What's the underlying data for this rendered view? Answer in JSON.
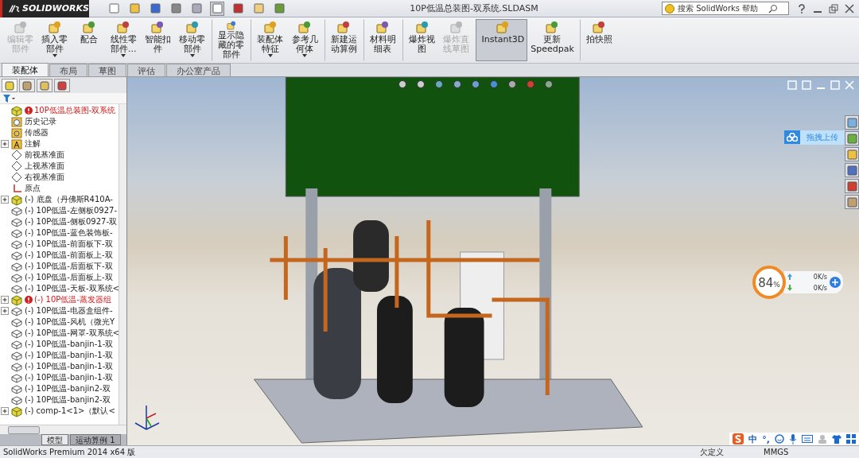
{
  "app": {
    "logo": "SOLIDWORKS",
    "title": "10P低温总装图-双系统.SLDASM"
  },
  "search": {
    "placeholder": "搜索 SolidWorks 帮助"
  },
  "quick_tools": [
    {
      "selected": false
    },
    {
      "selected": false
    },
    {
      "selected": false
    },
    {
      "selected": false
    },
    {
      "selected": false
    },
    {
      "selected": true
    },
    {
      "selected": false
    },
    {
      "selected": false
    },
    {
      "selected": false
    }
  ],
  "ribbon": [
    {
      "label": "编辑零部件",
      "disabled": true,
      "selected": false,
      "dropdown": false,
      "divider_before": false
    },
    {
      "label": "插入零部件",
      "disabled": false,
      "selected": false,
      "dropdown": true,
      "divider_before": false
    },
    {
      "label": "配合",
      "disabled": false,
      "selected": false,
      "dropdown": false,
      "divider_before": false
    },
    {
      "label": "线性零部件...",
      "disabled": false,
      "selected": false,
      "dropdown": true,
      "divider_before": false
    },
    {
      "label": "智能扣件",
      "disabled": false,
      "selected": false,
      "dropdown": false,
      "divider_before": false
    },
    {
      "label": "移动零部件",
      "disabled": false,
      "selected": false,
      "dropdown": true,
      "divider_before": false
    },
    {
      "label": "显示隐藏的零部件",
      "disabled": false,
      "selected": false,
      "dropdown": false,
      "divider_before": true
    },
    {
      "label": "装配体特征",
      "disabled": false,
      "selected": false,
      "dropdown": true,
      "divider_before": true
    },
    {
      "label": "参考几何体",
      "disabled": false,
      "selected": false,
      "dropdown": true,
      "divider_before": false
    },
    {
      "label": "新建运动算例",
      "disabled": false,
      "selected": false,
      "dropdown": false,
      "divider_before": true
    },
    {
      "label": "材料明细表",
      "disabled": false,
      "selected": false,
      "dropdown": false,
      "divider_before": true
    },
    {
      "label": "爆炸视图",
      "disabled": false,
      "selected": false,
      "dropdown": false,
      "divider_before": true
    },
    {
      "label": "爆炸直线草图",
      "disabled": true,
      "selected": false,
      "dropdown": false,
      "divider_before": false
    },
    {
      "label": "Instant3D",
      "disabled": false,
      "selected": true,
      "dropdown": false,
      "divider_before": true
    },
    {
      "label": "更新Speedpak",
      "disabled": false,
      "selected": false,
      "dropdown": false,
      "divider_before": false
    },
    {
      "label": "拍快照",
      "disabled": false,
      "selected": false,
      "dropdown": false,
      "divider_before": true
    }
  ],
  "tabs": [
    {
      "label": "装配体",
      "selected": true
    },
    {
      "label": "布局",
      "selected": false
    },
    {
      "label": "草图",
      "selected": false
    },
    {
      "label": "评估",
      "selected": false
    },
    {
      "label": "办公室产品",
      "selected": false
    }
  ],
  "panel_tabs": [
    {
      "selected": true
    },
    {
      "selected": false
    },
    {
      "selected": false
    },
    {
      "selected": false
    }
  ],
  "tree": [
    {
      "kind": "top",
      "label": "10P低温总装图-双系统",
      "expandable": false,
      "error": true
    },
    {
      "kind": "history",
      "label": "历史记录",
      "expandable": false,
      "error": false
    },
    {
      "kind": "sensor",
      "label": "传感器",
      "expandable": false,
      "error": false
    },
    {
      "kind": "annotation",
      "label": "注解",
      "expandable": true,
      "error": false
    },
    {
      "kind": "plane",
      "label": "前视基准面",
      "expandable": false,
      "error": false
    },
    {
      "kind": "plane",
      "label": "上视基准面",
      "expandable": false,
      "error": false
    },
    {
      "kind": "plane",
      "label": "右视基准面",
      "expandable": false,
      "error": false
    },
    {
      "kind": "origin",
      "label": "原点",
      "expandable": false,
      "error": false
    },
    {
      "kind": "assembly",
      "label": "(-) 底盘（丹佛斯R410A-",
      "expandable": true,
      "error": false
    },
    {
      "kind": "part",
      "label": "(-) 10P低温-左侧板0927-",
      "expandable": false,
      "error": false
    },
    {
      "kind": "part",
      "label": "(-) 10P低温-侧板0927-双",
      "expandable": false,
      "error": false
    },
    {
      "kind": "part",
      "label": "(-) 10P低温-蓝色装饰板-",
      "expandable": false,
      "error": false
    },
    {
      "kind": "part",
      "label": "(-) 10P低温-前面板下-双",
      "expandable": false,
      "error": false
    },
    {
      "kind": "part",
      "label": "(-) 10P低温-前面板上-双",
      "expandable": false,
      "error": false
    },
    {
      "kind": "part",
      "label": "(-) 10P低温-后面板下-双",
      "expandable": false,
      "error": false
    },
    {
      "kind": "part",
      "label": "(-) 10P低温-后面板上-双",
      "expandable": false,
      "error": false
    },
    {
      "kind": "part",
      "label": "(-) 10P低温-天板-双系统<",
      "expandable": false,
      "error": false
    },
    {
      "kind": "assembly",
      "label": "(-) 10P低温-蒸发器组",
      "expandable": true,
      "error": true
    },
    {
      "kind": "part",
      "label": "(-) 10P低温-电器盒组件-",
      "expandable": true,
      "error": false
    },
    {
      "kind": "part",
      "label": "(-) 10P低温-风机（微光Y",
      "expandable": false,
      "error": false
    },
    {
      "kind": "part",
      "label": "(-) 10P低温-网罩-双系统<",
      "expandable": false,
      "error": false
    },
    {
      "kind": "part",
      "label": "(-) 10P低温-banjin-1-双",
      "expandable": false,
      "error": false
    },
    {
      "kind": "part",
      "label": "(-) 10P低温-banjin-1-双",
      "expandable": false,
      "error": false
    },
    {
      "kind": "part",
      "label": "(-) 10P低温-banjin-1-双",
      "expandable": false,
      "error": false
    },
    {
      "kind": "part",
      "label": "(-) 10P低温-banjin-1-双",
      "expandable": false,
      "error": false
    },
    {
      "kind": "part",
      "label": "(-) 10P低温-banjin2-双",
      "expandable": false,
      "error": false
    },
    {
      "kind": "part",
      "label": "(-) 10P低温-banjin2-双",
      "expandable": false,
      "error": false
    },
    {
      "kind": "assembly",
      "label": "(-) comp-1<1>（默认<",
      "expandable": true,
      "error": false
    }
  ],
  "bottom_tabs": [
    {
      "label": "模型",
      "selected": true
    },
    {
      "label": "运动算例 1",
      "selected": false
    }
  ],
  "upload": {
    "label": "拖拽上传"
  },
  "speed_widget": {
    "percent": "84",
    "unit": "%",
    "upload": "0K/s",
    "download": "0K/s"
  },
  "ime": {
    "mode": "中",
    "punct": "°,"
  },
  "status_bar": {
    "product": "SolidWorks Premium 2014 x64 版",
    "state": "欠定义",
    "units": "MMGS"
  }
}
